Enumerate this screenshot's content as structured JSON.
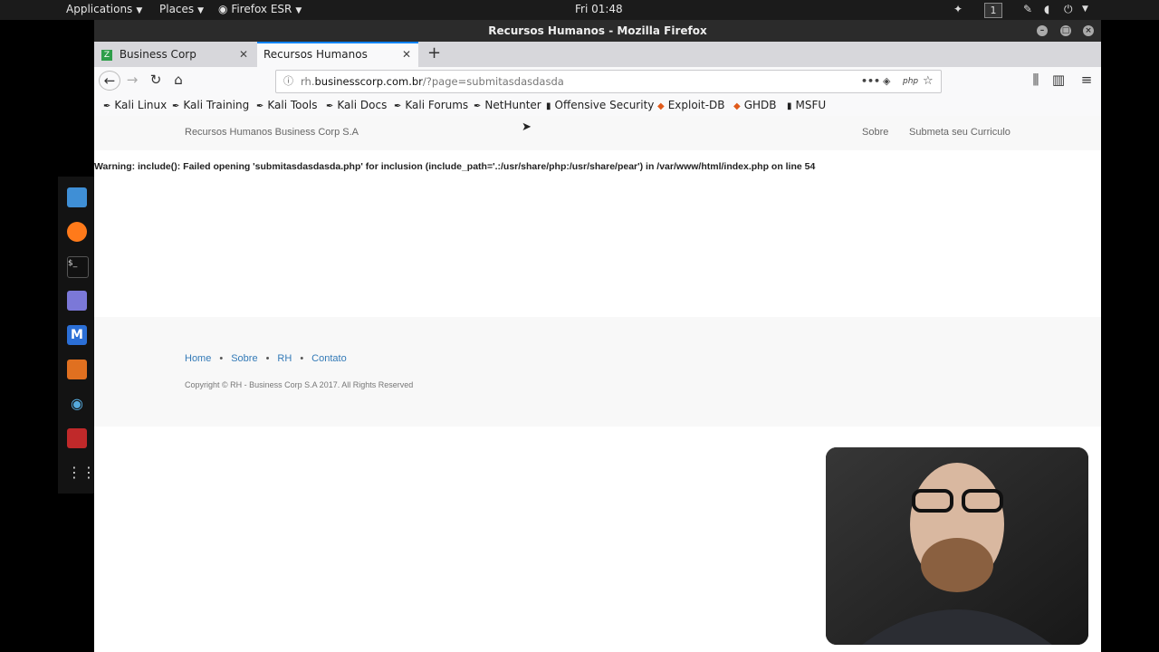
{
  "topbar": {
    "applications": "Applications",
    "places": "Places",
    "firefox": "Firefox ESR",
    "clock": "Fri 01:48",
    "workspace": "1"
  },
  "window": {
    "title": "Recursos Humanos - Mozilla Firefox",
    "tabs": [
      {
        "label": "Business Corp"
      },
      {
        "label": "Recursos Humanos"
      }
    ],
    "url_prefix": "rh.",
    "url_domain": "businesscorp.com.br",
    "url_path": "/?page=submitasdasdasda",
    "bookmarks": [
      "Kali Linux",
      "Kali Training",
      "Kali Tools",
      "Kali Docs",
      "Kali Forums",
      "NetHunter",
      "Offensive Security",
      "Exploit-DB",
      "GHDB",
      "MSFU"
    ]
  },
  "site": {
    "brand": "Recursos Humanos Business Corp S.A",
    "nav": [
      "Sobre",
      "Submeta seu Curriculo"
    ],
    "warning": "Warning: include(): Failed opening 'submitasdasdasda.php' for inclusion (include_path='.:/usr/share/php:/usr/share/pear') in /var/www/html/index.php on line 54",
    "footer_links": [
      "Home",
      "Sobre",
      "RH",
      "Contato"
    ],
    "copyright": "Copyright © RH - Business Corp S.A 2017. All Rights Reserved"
  },
  "colors": {
    "link": "#337ab7",
    "tab_accent": "#0a84ff",
    "topbar": "#1b1b1b"
  }
}
